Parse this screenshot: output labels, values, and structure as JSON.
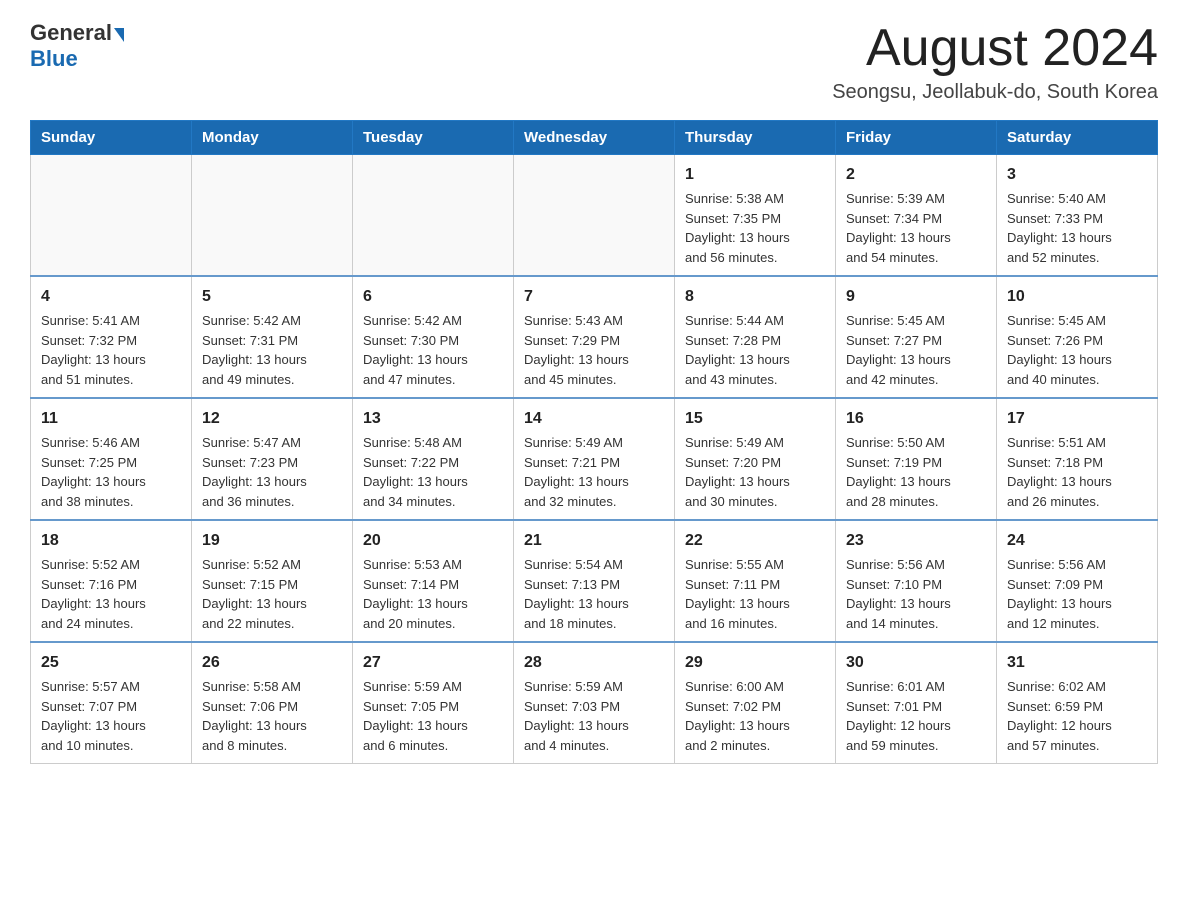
{
  "header": {
    "logo_general": "General",
    "logo_blue": "Blue",
    "month_title": "August 2024",
    "location": "Seongsu, Jeollabuk-do, South Korea"
  },
  "weekdays": [
    "Sunday",
    "Monday",
    "Tuesday",
    "Wednesday",
    "Thursday",
    "Friday",
    "Saturday"
  ],
  "weeks": [
    [
      {
        "day": "",
        "info": ""
      },
      {
        "day": "",
        "info": ""
      },
      {
        "day": "",
        "info": ""
      },
      {
        "day": "",
        "info": ""
      },
      {
        "day": "1",
        "info": "Sunrise: 5:38 AM\nSunset: 7:35 PM\nDaylight: 13 hours\nand 56 minutes."
      },
      {
        "day": "2",
        "info": "Sunrise: 5:39 AM\nSunset: 7:34 PM\nDaylight: 13 hours\nand 54 minutes."
      },
      {
        "day": "3",
        "info": "Sunrise: 5:40 AM\nSunset: 7:33 PM\nDaylight: 13 hours\nand 52 minutes."
      }
    ],
    [
      {
        "day": "4",
        "info": "Sunrise: 5:41 AM\nSunset: 7:32 PM\nDaylight: 13 hours\nand 51 minutes."
      },
      {
        "day": "5",
        "info": "Sunrise: 5:42 AM\nSunset: 7:31 PM\nDaylight: 13 hours\nand 49 minutes."
      },
      {
        "day": "6",
        "info": "Sunrise: 5:42 AM\nSunset: 7:30 PM\nDaylight: 13 hours\nand 47 minutes."
      },
      {
        "day": "7",
        "info": "Sunrise: 5:43 AM\nSunset: 7:29 PM\nDaylight: 13 hours\nand 45 minutes."
      },
      {
        "day": "8",
        "info": "Sunrise: 5:44 AM\nSunset: 7:28 PM\nDaylight: 13 hours\nand 43 minutes."
      },
      {
        "day": "9",
        "info": "Sunrise: 5:45 AM\nSunset: 7:27 PM\nDaylight: 13 hours\nand 42 minutes."
      },
      {
        "day": "10",
        "info": "Sunrise: 5:45 AM\nSunset: 7:26 PM\nDaylight: 13 hours\nand 40 minutes."
      }
    ],
    [
      {
        "day": "11",
        "info": "Sunrise: 5:46 AM\nSunset: 7:25 PM\nDaylight: 13 hours\nand 38 minutes."
      },
      {
        "day": "12",
        "info": "Sunrise: 5:47 AM\nSunset: 7:23 PM\nDaylight: 13 hours\nand 36 minutes."
      },
      {
        "day": "13",
        "info": "Sunrise: 5:48 AM\nSunset: 7:22 PM\nDaylight: 13 hours\nand 34 minutes."
      },
      {
        "day": "14",
        "info": "Sunrise: 5:49 AM\nSunset: 7:21 PM\nDaylight: 13 hours\nand 32 minutes."
      },
      {
        "day": "15",
        "info": "Sunrise: 5:49 AM\nSunset: 7:20 PM\nDaylight: 13 hours\nand 30 minutes."
      },
      {
        "day": "16",
        "info": "Sunrise: 5:50 AM\nSunset: 7:19 PM\nDaylight: 13 hours\nand 28 minutes."
      },
      {
        "day": "17",
        "info": "Sunrise: 5:51 AM\nSunset: 7:18 PM\nDaylight: 13 hours\nand 26 minutes."
      }
    ],
    [
      {
        "day": "18",
        "info": "Sunrise: 5:52 AM\nSunset: 7:16 PM\nDaylight: 13 hours\nand 24 minutes."
      },
      {
        "day": "19",
        "info": "Sunrise: 5:52 AM\nSunset: 7:15 PM\nDaylight: 13 hours\nand 22 minutes."
      },
      {
        "day": "20",
        "info": "Sunrise: 5:53 AM\nSunset: 7:14 PM\nDaylight: 13 hours\nand 20 minutes."
      },
      {
        "day": "21",
        "info": "Sunrise: 5:54 AM\nSunset: 7:13 PM\nDaylight: 13 hours\nand 18 minutes."
      },
      {
        "day": "22",
        "info": "Sunrise: 5:55 AM\nSunset: 7:11 PM\nDaylight: 13 hours\nand 16 minutes."
      },
      {
        "day": "23",
        "info": "Sunrise: 5:56 AM\nSunset: 7:10 PM\nDaylight: 13 hours\nand 14 minutes."
      },
      {
        "day": "24",
        "info": "Sunrise: 5:56 AM\nSunset: 7:09 PM\nDaylight: 13 hours\nand 12 minutes."
      }
    ],
    [
      {
        "day": "25",
        "info": "Sunrise: 5:57 AM\nSunset: 7:07 PM\nDaylight: 13 hours\nand 10 minutes."
      },
      {
        "day": "26",
        "info": "Sunrise: 5:58 AM\nSunset: 7:06 PM\nDaylight: 13 hours\nand 8 minutes."
      },
      {
        "day": "27",
        "info": "Sunrise: 5:59 AM\nSunset: 7:05 PM\nDaylight: 13 hours\nand 6 minutes."
      },
      {
        "day": "28",
        "info": "Sunrise: 5:59 AM\nSunset: 7:03 PM\nDaylight: 13 hours\nand 4 minutes."
      },
      {
        "day": "29",
        "info": "Sunrise: 6:00 AM\nSunset: 7:02 PM\nDaylight: 13 hours\nand 2 minutes."
      },
      {
        "day": "30",
        "info": "Sunrise: 6:01 AM\nSunset: 7:01 PM\nDaylight: 12 hours\nand 59 minutes."
      },
      {
        "day": "31",
        "info": "Sunrise: 6:02 AM\nSunset: 6:59 PM\nDaylight: 12 hours\nand 57 minutes."
      }
    ]
  ]
}
